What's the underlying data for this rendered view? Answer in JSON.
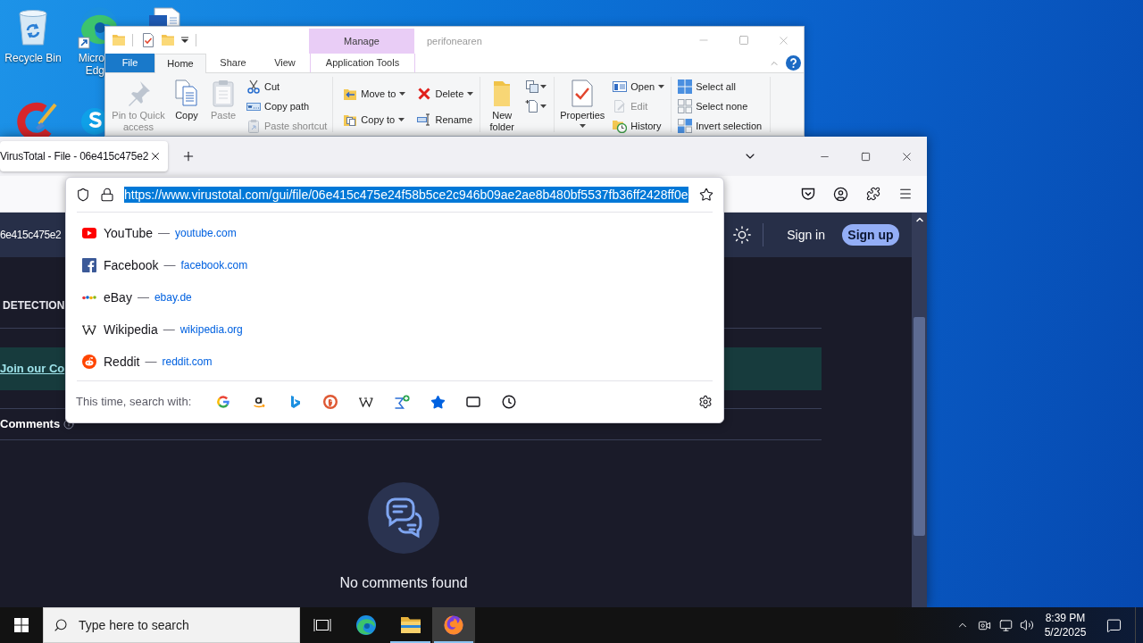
{
  "desktop_icons": [
    {
      "label_lines": [
        "Recycle Bin"
      ]
    },
    {
      "label_lines": [
        "Micro",
        "Edg"
      ]
    }
  ],
  "explorer": {
    "context_group": "Manage",
    "title": "perifonearen",
    "tabs": [
      {
        "label": "File",
        "kind": "file",
        "selected": false
      },
      {
        "label": "Home",
        "kind": "tab",
        "selected": true
      },
      {
        "label": "Share",
        "kind": "tab",
        "selected": false
      },
      {
        "label": "View",
        "kind": "tab",
        "selected": false
      },
      {
        "label": "Application Tools",
        "kind": "context",
        "selected": false
      }
    ],
    "ribbon_groups": [
      {
        "columns": [
          [
            {
              "kind": "large",
              "label": "Pin to Quick access",
              "dropdown": false,
              "disabled": true
            }
          ],
          [
            {
              "kind": "large",
              "label": "Copy",
              "dropdown": false,
              "disabled": false
            }
          ],
          [
            {
              "kind": "large",
              "label": "Paste",
              "dropdown": false,
              "disabled": true
            }
          ],
          [
            {
              "kind": "small",
              "label": "Cut",
              "dropdown": false,
              "disabled": false
            },
            {
              "kind": "small",
              "label": "Copy path",
              "dropdown": false,
              "disabled": false
            },
            {
              "kind": "small",
              "label": "Paste shortcut",
              "dropdown": false,
              "disabled": true
            }
          ]
        ]
      },
      {
        "columns": [
          [
            {
              "kind": "small",
              "label": "Move to",
              "dropdown": true,
              "disabled": false
            },
            {
              "kind": "small",
              "label": "Copy to",
              "dropdown": true,
              "disabled": false
            }
          ],
          [
            {
              "kind": "small",
              "label": "Delete",
              "dropdown": true,
              "disabled": false
            },
            {
              "kind": "small",
              "label": "Rename",
              "dropdown": false,
              "disabled": false
            }
          ]
        ]
      },
      {
        "columns": [
          [
            {
              "kind": "large",
              "label": "New folder",
              "dropdown": false,
              "disabled": false
            }
          ],
          [
            {
              "kind": "icon",
              "dropdown": true,
              "disabled": false
            },
            {
              "kind": "icon",
              "dropdown": true,
              "disabled": false
            }
          ]
        ]
      },
      {
        "columns": [
          [
            {
              "kind": "large",
              "label": "Properties",
              "dropdown": true,
              "disabled": false
            }
          ],
          [
            {
              "kind": "small",
              "label": "Open",
              "dropdown": true,
              "disabled": false
            },
            {
              "kind": "small",
              "label": "Edit",
              "dropdown": false,
              "disabled": true
            },
            {
              "kind": "small",
              "label": "History",
              "dropdown": false,
              "disabled": false
            }
          ]
        ]
      },
      {
        "columns": [
          [
            {
              "kind": "small",
              "label": "Select all",
              "dropdown": false,
              "disabled": false
            },
            {
              "kind": "small",
              "label": "Select none",
              "dropdown": false,
              "disabled": false
            },
            {
              "kind": "small",
              "label": "Invert selection",
              "dropdown": false,
              "disabled": false
            }
          ]
        ]
      }
    ]
  },
  "browser": {
    "tabs": [
      {
        "title": "VirusTotal - File - 06e415c475e2",
        "selected": true
      }
    ],
    "address": {
      "url": "https://www.virustotal.com/gui/file/06e415c475e24f58b5ce2c946b09ae2ae8b480bf5537fb36ff2428ff0e",
      "selected": true
    },
    "suggestions": [
      {
        "title": "YouTube",
        "separator": "—",
        "domain": "youtube.com"
      },
      {
        "title": "Facebook",
        "separator": "—",
        "domain": "facebook.com"
      },
      {
        "title": "eBay",
        "separator": "—",
        "domain": "ebay.de"
      },
      {
        "title": "Wikipedia",
        "separator": "—",
        "domain": "wikipedia.org"
      },
      {
        "title": "Reddit",
        "separator": "—",
        "domain": "reddit.com"
      }
    ],
    "search_with_label": "This time, search with:",
    "page": {
      "file_id": "6e415c475e2",
      "sign_in": "Sign in",
      "sign_up": "Sign up",
      "section_heading": "DETECTION",
      "banner_link": "Join our Co",
      "comments_heading": "Comments",
      "empty_message": "No comments found"
    }
  },
  "taskbar": {
    "search_placeholder": "Type here to search",
    "apps": [
      {
        "running": false,
        "selected": false
      },
      {
        "running": true,
        "selected": false
      },
      {
        "running": true,
        "selected": true
      }
    ],
    "clock": {
      "time": "8:39 PM",
      "date": "5/2/2025"
    }
  }
}
